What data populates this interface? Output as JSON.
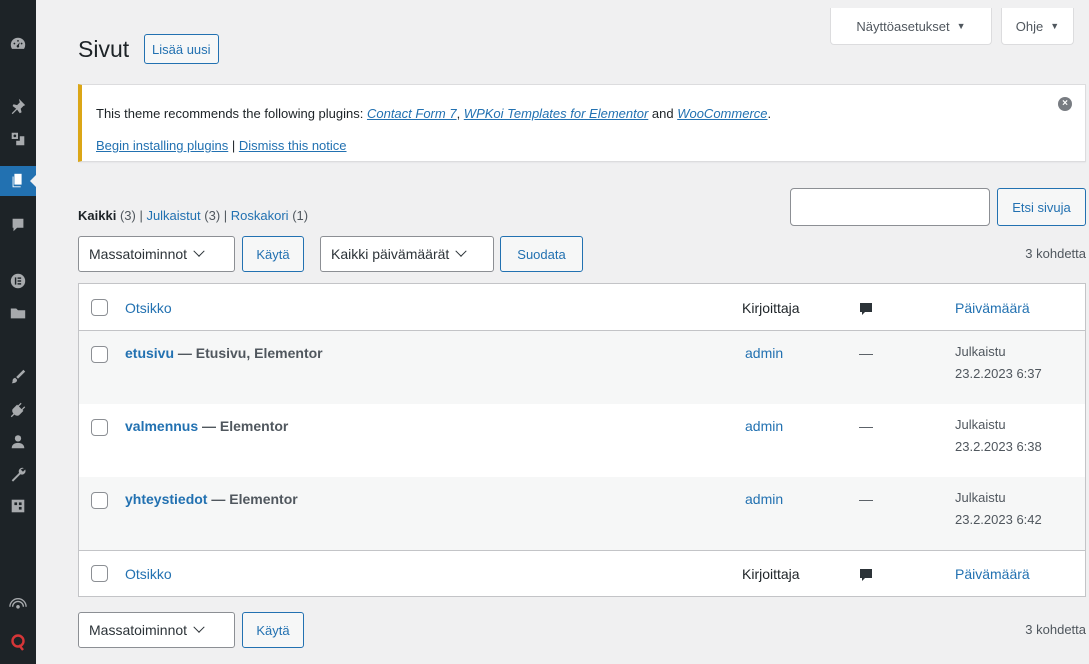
{
  "screen_meta": {
    "screen_options": "Näyttöasetukset",
    "help": "Ohje"
  },
  "page": {
    "title": "Sivut",
    "add_new": "Lisää uusi"
  },
  "notice": {
    "text_before": "This theme recommends the following plugins: ",
    "plugin1": "Contact Form 7",
    "sep1": ", ",
    "plugin2": "WPKoi Templates for Elementor",
    "sep2": " and ",
    "plugin3": "WooCommerce",
    "text_after": ".",
    "begin_link": "Begin installing plugins",
    "divider": " | ",
    "dismiss_link": "Dismiss this notice"
  },
  "views": {
    "all_label": "Kaikki",
    "all_count": "(3)",
    "published_label": "Julkaistut",
    "published_count": "(3)",
    "trash_label": "Roskakori",
    "trash_count": "(1)",
    "separator": " | "
  },
  "search": {
    "value": "",
    "button": "Etsi sivuja"
  },
  "tablenav_top": {
    "bulk_action": "Massatoiminnot",
    "apply": "Käytä",
    "date_filter": "Kaikki päivämäärät",
    "filter": "Suodata",
    "items": "3 kohdetta"
  },
  "table": {
    "columns": {
      "title": "Otsikko",
      "author": "Kirjoittaja",
      "date": "Päivämäärä"
    },
    "rows": [
      {
        "title": "etusivu",
        "state": " — Etusivu, Elementor",
        "author": "admin",
        "comments": "—",
        "status": "Julkaistu",
        "date": "23.2.2023 6:37"
      },
      {
        "title": "valmennus",
        "state": " — Elementor",
        "author": "admin",
        "comments": "—",
        "status": "Julkaistu",
        "date": "23.2.2023 6:38"
      },
      {
        "title": "yhteystiedot",
        "state": " — Elementor",
        "author": "admin",
        "comments": "—",
        "status": "Julkaistu",
        "date": "23.2.2023 6:42"
      }
    ]
  },
  "tablenav_bottom": {
    "bulk_action": "Massatoiminnot",
    "apply": "Käytä",
    "items": "3 kohdetta"
  },
  "sidebar_icons": [
    "dashboard-icon",
    "posts-pin-icon",
    "media-icon",
    "pages-icon",
    "comments-icon",
    "elementor-icon",
    "templates-folder-icon",
    "appearance-brush-icon",
    "plugins-icon",
    "users-icon",
    "tools-wrench-icon",
    "settings-icon",
    "wifi-plugin-icon",
    "q-plugin-icon"
  ],
  "colors": {
    "accent": "#2271b1",
    "sidebar": "#1d2327",
    "notice_border": "#dba617"
  }
}
